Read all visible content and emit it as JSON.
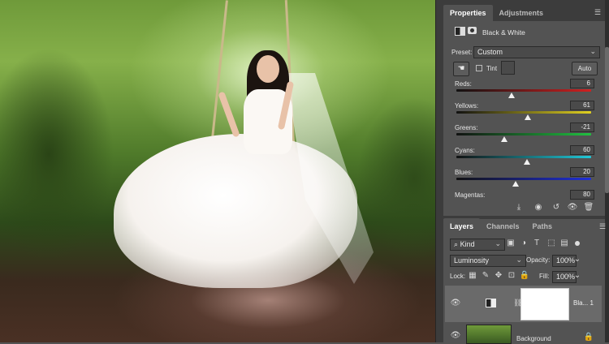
{
  "canvas": {
    "description_icon": "photo-canvas"
  },
  "properties": {
    "tabs": [
      {
        "label": "Properties"
      },
      {
        "label": "Adjustments"
      }
    ],
    "title": "Black & White",
    "preset_label": "Preset:",
    "preset_value": "Custom",
    "tint_label": "Tint",
    "auto_label": "Auto",
    "sliders": [
      {
        "label": "Reds:",
        "value": "6"
      },
      {
        "label": "Yellows:",
        "value": "61"
      },
      {
        "label": "Greens:",
        "value": "-21"
      },
      {
        "label": "Cyans:",
        "value": "60"
      },
      {
        "label": "Blues:",
        "value": "20"
      },
      {
        "label": "Magentas:",
        "value": "80"
      }
    ]
  },
  "layers": {
    "tabs": [
      {
        "label": "Layers"
      },
      {
        "label": "Channels"
      },
      {
        "label": "Paths"
      }
    ],
    "filter_label": "Kind",
    "blend_mode": "Luminosity",
    "opacity_label": "Opacity:",
    "opacity_value": "100%",
    "lock_label": "Lock:",
    "fill_label": "Fill:",
    "fill_value": "100%",
    "items": [
      {
        "name": "Bla... 1"
      },
      {
        "name": "Background"
      }
    ]
  }
}
